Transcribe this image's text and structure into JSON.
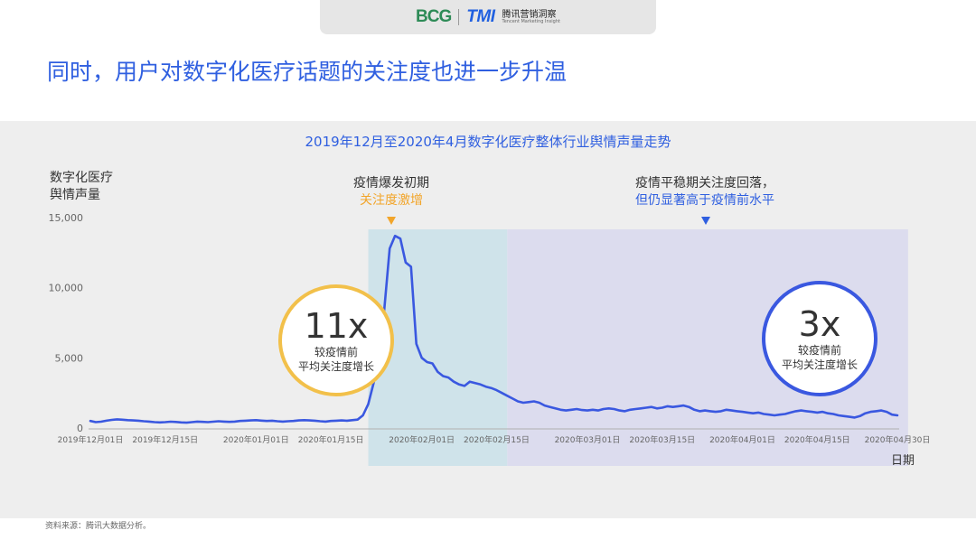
{
  "header": {
    "bcg_logo": "BCG",
    "tmi_logo": "TMI",
    "tmi_name_cn": "腾讯营销洞察",
    "tmi_name_en": "Tencent Marketing Insight"
  },
  "slide_title": "同时，用户对数字化医疗话题的关注度也进一步升温",
  "footnote": "资料来源：腾讯大数据分析。",
  "annotations": {
    "outbreak_title": "疫情爆发初期",
    "outbreak_sub": "关注度激增",
    "stable_title": "疫情平稳期关注度回落，",
    "stable_sub": "但仍显著高于疫情前水平"
  },
  "badges": {
    "left_big": "11x",
    "left_line1": "较疫情前",
    "left_line2": "平均关注度增长",
    "right_big": "3x",
    "right_line1": "较疫情前",
    "right_line2": "平均关注度增长"
  },
  "colors": {
    "line": "#3a58e0",
    "outbreak_band": "#cfe3ea",
    "stable_band": "#dcdcee",
    "accent_orange": "#f2a52a",
    "title_blue": "#2f5fe0"
  },
  "chart_data": {
    "type": "line",
    "title": "2019年12月至2020年4月数字化医疗整体行业舆情声量走势",
    "ylabel_line1": "数字化医疗",
    "ylabel_line2": "舆情声量",
    "xlabel": "日期",
    "ylim": [
      0,
      15000
    ],
    "yticks": [
      0,
      5000,
      10000,
      15000
    ],
    "ytick_labels": [
      "0",
      "5,000",
      "10,000",
      "15,000"
    ],
    "xticks": [
      0,
      14,
      31,
      45,
      62,
      76,
      93,
      107,
      122,
      136,
      151
    ],
    "xtick_labels": [
      "2019年12月01日",
      "2019年12月15日",
      "2020年01月01日",
      "2020年01月15日",
      "2020年02月01日",
      "2020年02月15日",
      "2020年03月01日",
      "2020年03月15日",
      "2020年04月01日",
      "2020年04月15日",
      "2020年04月30日"
    ],
    "x_range_days": [
      0,
      151
    ],
    "bands": [
      {
        "phase": "outbreak",
        "x_start_day": 52,
        "x_end_day": 78
      },
      {
        "phase": "stable",
        "x_start_day": 78,
        "x_end_day": 153
      }
    ],
    "series": [
      {
        "values": [
          [
            0,
            500
          ],
          [
            1,
            420
          ],
          [
            2,
            450
          ],
          [
            3,
            520
          ],
          [
            4,
            580
          ],
          [
            5,
            620
          ],
          [
            6,
            590
          ],
          [
            7,
            560
          ],
          [
            8,
            540
          ],
          [
            9,
            520
          ],
          [
            10,
            480
          ],
          [
            11,
            460
          ],
          [
            12,
            420
          ],
          [
            13,
            400
          ],
          [
            14,
            420
          ],
          [
            15,
            450
          ],
          [
            16,
            430
          ],
          [
            17,
            400
          ],
          [
            18,
            380
          ],
          [
            19,
            420
          ],
          [
            20,
            460
          ],
          [
            21,
            440
          ],
          [
            22,
            420
          ],
          [
            23,
            450
          ],
          [
            24,
            480
          ],
          [
            25,
            460
          ],
          [
            26,
            440
          ],
          [
            27,
            460
          ],
          [
            28,
            500
          ],
          [
            29,
            520
          ],
          [
            30,
            540
          ],
          [
            31,
            560
          ],
          [
            32,
            530
          ],
          [
            33,
            500
          ],
          [
            34,
            520
          ],
          [
            35,
            480
          ],
          [
            36,
            460
          ],
          [
            37,
            480
          ],
          [
            38,
            500
          ],
          [
            39,
            540
          ],
          [
            40,
            560
          ],
          [
            41,
            540
          ],
          [
            42,
            520
          ],
          [
            43,
            480
          ],
          [
            44,
            460
          ],
          [
            45,
            500
          ],
          [
            46,
            520
          ],
          [
            47,
            540
          ],
          [
            48,
            520
          ],
          [
            49,
            560
          ],
          [
            50,
            600
          ],
          [
            51,
            900
          ],
          [
            52,
            1700
          ],
          [
            53,
            3200
          ],
          [
            54,
            5200
          ],
          [
            55,
            8500
          ],
          [
            56,
            12800
          ],
          [
            57,
            13700
          ],
          [
            58,
            13500
          ],
          [
            59,
            11800
          ],
          [
            60,
            11500
          ],
          [
            61,
            6000
          ],
          [
            62,
            5000
          ],
          [
            63,
            4700
          ],
          [
            64,
            4600
          ],
          [
            65,
            4000
          ],
          [
            66,
            3700
          ],
          [
            67,
            3600
          ],
          [
            68,
            3300
          ],
          [
            69,
            3100
          ],
          [
            70,
            3000
          ],
          [
            71,
            3300
          ],
          [
            72,
            3200
          ],
          [
            73,
            3100
          ],
          [
            74,
            2950
          ],
          [
            75,
            2850
          ],
          [
            76,
            2700
          ],
          [
            77,
            2500
          ],
          [
            78,
            2300
          ],
          [
            79,
            2100
          ],
          [
            80,
            1900
          ],
          [
            81,
            1800
          ],
          [
            82,
            1850
          ],
          [
            83,
            1900
          ],
          [
            84,
            1800
          ],
          [
            85,
            1600
          ],
          [
            86,
            1500
          ],
          [
            87,
            1400
          ],
          [
            88,
            1300
          ],
          [
            89,
            1250
          ],
          [
            90,
            1300
          ],
          [
            91,
            1350
          ],
          [
            92,
            1280
          ],
          [
            93,
            1250
          ],
          [
            94,
            1300
          ],
          [
            95,
            1250
          ],
          [
            96,
            1350
          ],
          [
            97,
            1400
          ],
          [
            98,
            1350
          ],
          [
            99,
            1250
          ],
          [
            100,
            1200
          ],
          [
            101,
            1300
          ],
          [
            102,
            1350
          ],
          [
            103,
            1400
          ],
          [
            104,
            1450
          ],
          [
            105,
            1500
          ],
          [
            106,
            1400
          ],
          [
            107,
            1450
          ],
          [
            108,
            1550
          ],
          [
            109,
            1500
          ],
          [
            110,
            1550
          ],
          [
            111,
            1600
          ],
          [
            112,
            1500
          ],
          [
            113,
            1300
          ],
          [
            114,
            1200
          ],
          [
            115,
            1250
          ],
          [
            116,
            1200
          ],
          [
            117,
            1150
          ],
          [
            118,
            1200
          ],
          [
            119,
            1300
          ],
          [
            120,
            1250
          ],
          [
            121,
            1200
          ],
          [
            122,
            1150
          ],
          [
            123,
            1100
          ],
          [
            124,
            1050
          ],
          [
            125,
            1100
          ],
          [
            126,
            1000
          ],
          [
            127,
            950
          ],
          [
            128,
            900
          ],
          [
            129,
            950
          ],
          [
            130,
            1000
          ],
          [
            131,
            1100
          ],
          [
            132,
            1200
          ],
          [
            133,
            1250
          ],
          [
            134,
            1200
          ],
          [
            135,
            1150
          ],
          [
            136,
            1100
          ],
          [
            137,
            1150
          ],
          [
            138,
            1050
          ],
          [
            139,
            1000
          ],
          [
            140,
            900
          ],
          [
            141,
            850
          ],
          [
            142,
            800
          ],
          [
            143,
            750
          ],
          [
            144,
            850
          ],
          [
            145,
            1050
          ],
          [
            146,
            1150
          ],
          [
            147,
            1200
          ],
          [
            148,
            1250
          ],
          [
            149,
            1150
          ],
          [
            150,
            950
          ],
          [
            151,
            900
          ]
        ]
      }
    ]
  }
}
